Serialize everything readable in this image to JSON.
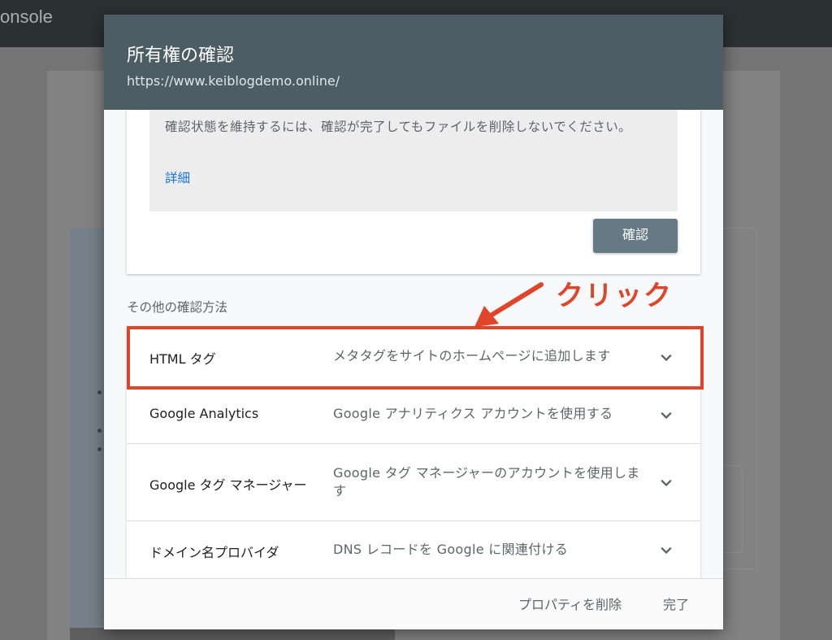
{
  "background": {
    "brand_fragment": "onsole"
  },
  "dialog": {
    "title": "所有権の確認",
    "url": "https://www.keiblogdemo.online/",
    "note_text": "確認状態を維持するには、確認が完了してもファイルを削除しないでください。",
    "details_link": "詳細",
    "verify_button": "確認",
    "other_methods_label": "その他の確認方法",
    "methods": [
      {
        "name": "HTML タグ",
        "description": "メタタグをサイトのホームページに追加します"
      },
      {
        "name": "Google Analytics",
        "description": "Google アナリティクス アカウントを使用する"
      },
      {
        "name": "Google タグ マネージャー",
        "description": "Google タグ マネージャーのアカウントを使用します"
      },
      {
        "name": "ドメイン名プロバイダ",
        "description": "DNS レコードを Google に関連付ける"
      }
    ],
    "footer": {
      "delete_property": "プロパティを削除",
      "done": "完了"
    }
  },
  "annotation": {
    "label": "クリック",
    "color": "#e0452a"
  },
  "colors": {
    "header": "#4c5d66",
    "verify_button": "#667a84",
    "link": "#1a73e8"
  }
}
